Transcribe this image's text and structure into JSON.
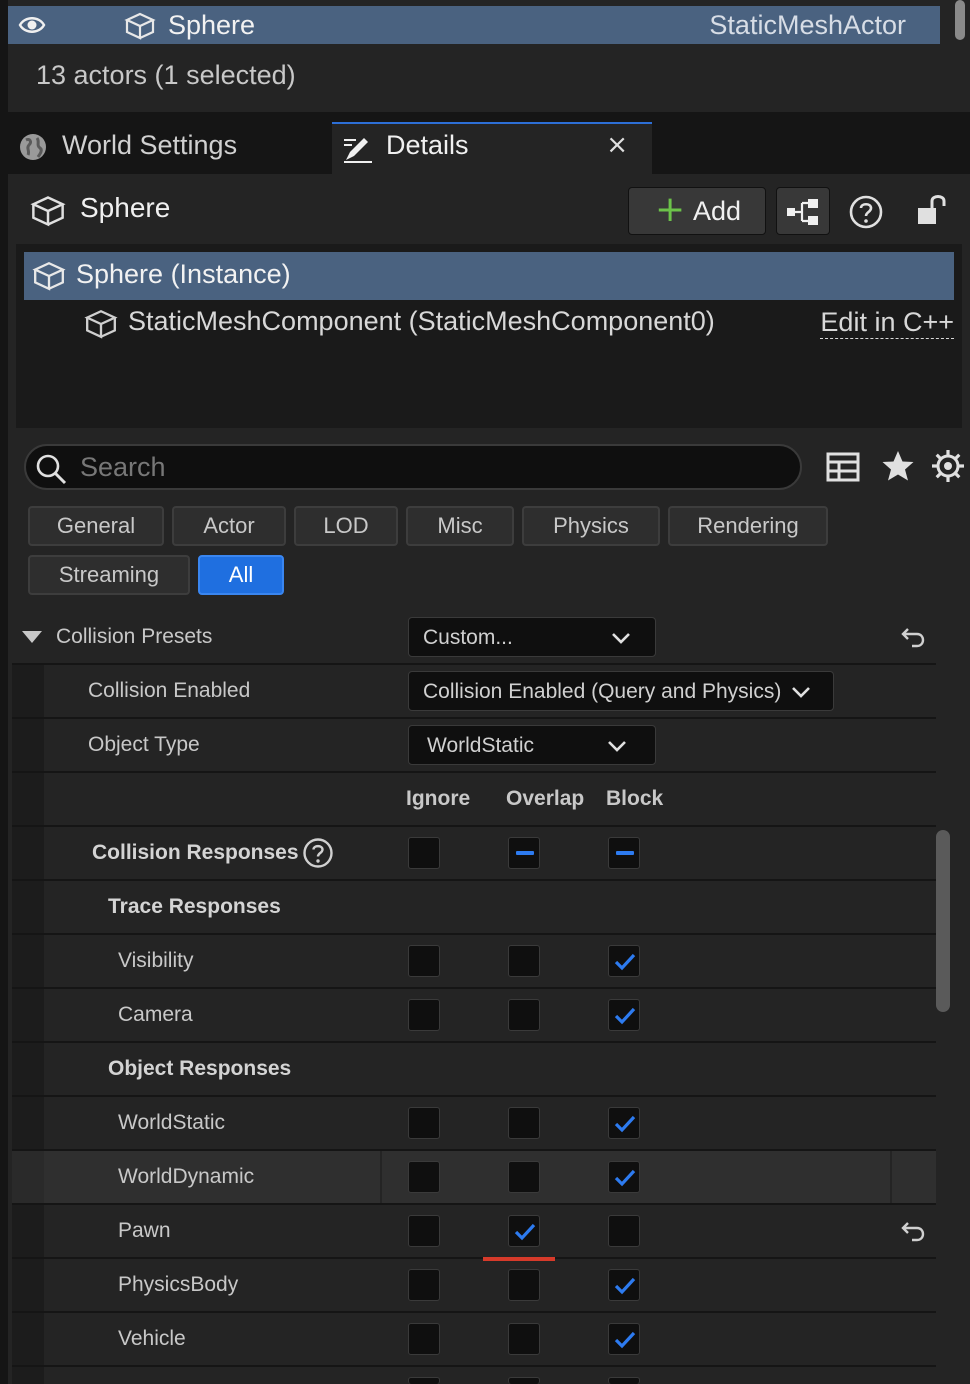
{
  "outliner": {
    "selected_row": {
      "name": "Sphere",
      "type": "StaticMeshActor"
    },
    "actor_count": "13 actors (1 selected)"
  },
  "tabs": {
    "world_settings": "World Settings",
    "details": "Details",
    "close_glyph": "×"
  },
  "details_header": {
    "object_name": "Sphere",
    "add_label": "Add",
    "add_glyph": "+"
  },
  "components": {
    "root": "Sphere (Instance)",
    "child": "StaticMeshComponent (StaticMeshComponent0)",
    "edit_link": "Edit in C++"
  },
  "search": {
    "placeholder": "Search"
  },
  "filters": [
    {
      "label": "General",
      "active": false
    },
    {
      "label": "Actor",
      "active": false
    },
    {
      "label": "LOD",
      "active": false
    },
    {
      "label": "Misc",
      "active": false
    },
    {
      "label": "Physics",
      "active": false
    },
    {
      "label": "Rendering",
      "active": false
    },
    {
      "label": "Streaming",
      "active": false
    },
    {
      "label": "All",
      "active": true
    }
  ],
  "collision": {
    "presets_label": "Collision Presets",
    "presets_value": "Custom...",
    "enabled_label": "Collision Enabled",
    "enabled_value": "Collision Enabled (Query and Physics)",
    "object_type_label": "Object Type",
    "object_type_value": "WorldStatic",
    "columns": {
      "ignore": "Ignore",
      "overlap": "Overlap",
      "block": "Block"
    },
    "responses_label": "Collision Responses",
    "trace_label": "Trace Responses",
    "object_label": "Object Responses",
    "channels": [
      {
        "name": "Visibility",
        "ignore": false,
        "overlap": false,
        "block": true
      },
      {
        "name": "Camera",
        "ignore": false,
        "overlap": false,
        "block": true
      },
      {
        "name": "WorldStatic",
        "ignore": false,
        "overlap": false,
        "block": true
      },
      {
        "name": "WorldDynamic",
        "ignore": false,
        "overlap": false,
        "block": true
      },
      {
        "name": "Pawn",
        "ignore": false,
        "overlap": true,
        "block": false
      },
      {
        "name": "PhysicsBody",
        "ignore": false,
        "overlap": false,
        "block": true
      },
      {
        "name": "Vehicle",
        "ignore": false,
        "overlap": false,
        "block": true
      }
    ]
  },
  "colors": {
    "selection": "#4a6280",
    "accent_blue": "#1f6fe0",
    "add_green": "#6cc24a",
    "highlight_red": "#d63a2a"
  }
}
